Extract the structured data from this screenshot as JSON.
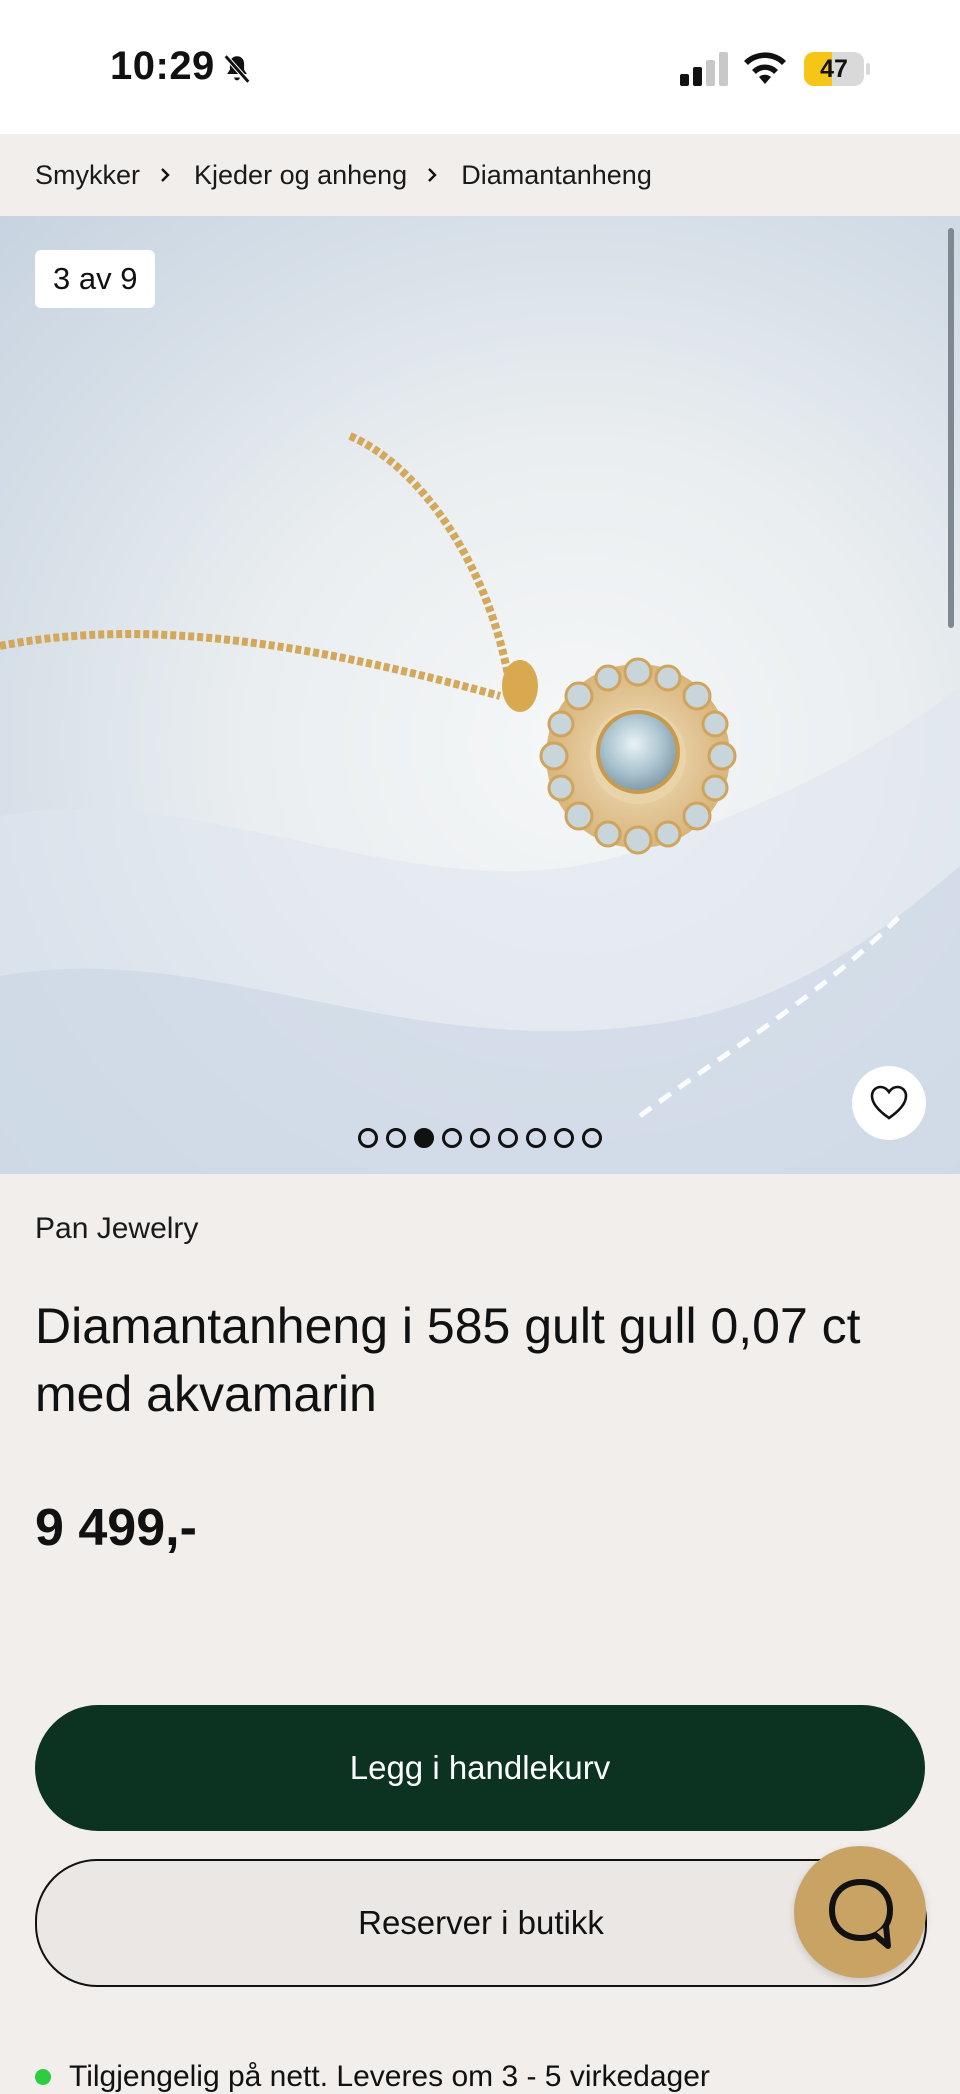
{
  "status_bar": {
    "time": "10:29",
    "battery": "47",
    "battery_level": 0.47
  },
  "breadcrumb": {
    "items": [
      "Smykker",
      "Kjeder og anheng",
      "Diamantanheng"
    ]
  },
  "gallery": {
    "counter": "3 av 9",
    "total": 9,
    "active_index": 2
  },
  "product": {
    "brand": "Pan Jewelry",
    "title": "Diamantanheng i 585 gult gull 0,07 ct med akvamarin",
    "price": "9 499,-"
  },
  "actions": {
    "add_to_cart": "Legg i handlekurv",
    "reserve": "Reserver i butikk"
  },
  "availability": {
    "text": "Tilgjengelig på nett. Leveres om 3 - 5 virkedager"
  },
  "colors": {
    "primary": "#0c3322",
    "background": "#f1eeeb",
    "chat": "#c9a363",
    "available": "#2ecc40",
    "battery": "#f5c518"
  },
  "icons": [
    "bell-muted-icon",
    "signal-icon",
    "wifi-icon",
    "battery-icon",
    "chevron-right-icon",
    "heart-icon",
    "chat-icon"
  ]
}
